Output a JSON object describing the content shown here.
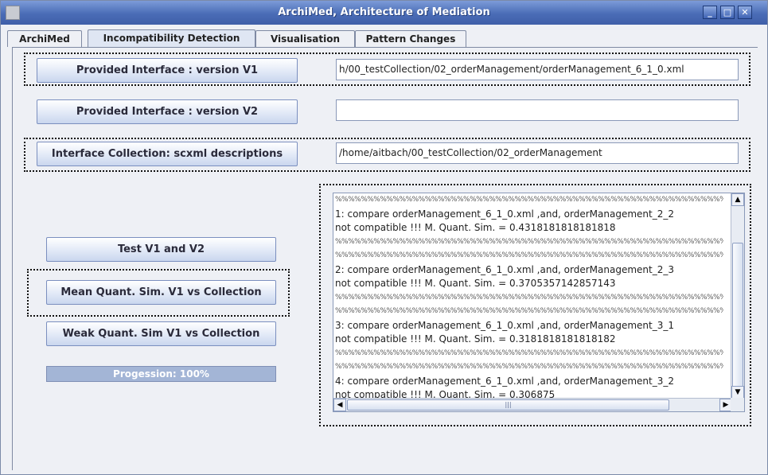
{
  "window": {
    "title": "ArchiMed, Architecture of Mediation"
  },
  "window_controls": {
    "minimize": "_",
    "maximize": "□",
    "close": "✕"
  },
  "tabs": [
    {
      "label": "ArchiMed"
    },
    {
      "label": "Incompatibility Detection"
    },
    {
      "label": "Visualisation"
    },
    {
      "label": "Pattern Changes"
    }
  ],
  "form": {
    "v1_button": "Provided Interface : version V1",
    "v1_value": "h/00_testCollection/02_orderManagement/orderManagement_6_1_0.xml",
    "v2_button": "Provided Interface : version V2",
    "v2_value": "",
    "collection_button": "Interface Collection: scxml descriptions",
    "collection_value": "/home/aitbach/00_testCollection/02_orderManagement"
  },
  "actions": {
    "test": "Test V1 and V2",
    "mean": "Mean Quant. Sim. V1 vs Collection",
    "weak": "Weak Quant. Sim V1 vs Collection"
  },
  "progress": {
    "label": "Progession: 100%",
    "percent": 100
  },
  "log": {
    "separator": "%%%%%%%%%%%%%%%%%%%%%%%%%%%%%%%%%%%%%%%%%%%%%%%%%%%%%%%%%%%%%%%%",
    "lines": [
      "1: compare orderManagement_6_1_0.xml ,and, orderManagement_2_2",
      "not compatible !!! M. Quant. Sim. = 0.4318181818181818",
      "2: compare orderManagement_6_1_0.xml ,and, orderManagement_2_3",
      "not compatible !!! M. Quant. Sim. = 0.3705357142857143",
      "3: compare orderManagement_6_1_0.xml ,and, orderManagement_3_1",
      "not compatible !!! M. Quant. Sim. = 0.3181818181818182",
      "4: compare orderManagement_6_1_0.xml ,and, orderManagement_3_2",
      "not compatible !!! M. Quant. Sim. = 0.306875"
    ]
  },
  "scroll_icons": {
    "up": "▲",
    "down": "▼",
    "left": "◀",
    "right": "▶",
    "grip": "|||"
  }
}
